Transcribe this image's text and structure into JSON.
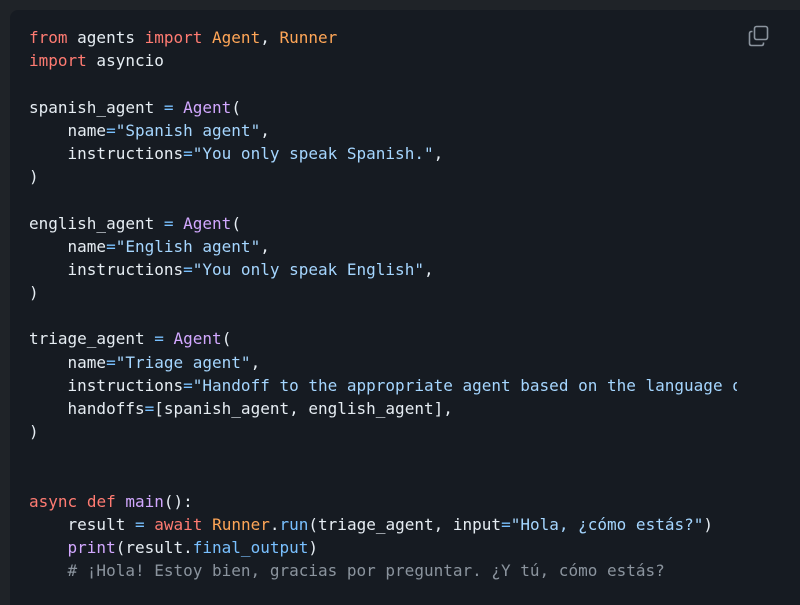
{
  "copy_icon": "copy-icon",
  "colors": {
    "background": "#161b22",
    "text": "#e6edf3",
    "keyword": "#ff7b72",
    "class": "#ffa657",
    "function": "#d2a8ff",
    "string": "#a5d6ff",
    "operator": "#79c0ff",
    "comment": "#8b949e"
  },
  "code_lines": [
    [
      {
        "t": "from",
        "c": "kw"
      },
      {
        "t": " agents ",
        "c": "id"
      },
      {
        "t": "import",
        "c": "kw"
      },
      {
        "t": " ",
        "c": "id"
      },
      {
        "t": "Agent",
        "c": "cls"
      },
      {
        "t": ", ",
        "c": "id"
      },
      {
        "t": "Runner",
        "c": "cls"
      }
    ],
    [
      {
        "t": "import",
        "c": "kw"
      },
      {
        "t": " asyncio",
        "c": "id"
      }
    ],
    [],
    [
      {
        "t": "spanish_agent ",
        "c": "id"
      },
      {
        "t": "=",
        "c": "op"
      },
      {
        "t": " ",
        "c": "id"
      },
      {
        "t": "Agent",
        "c": "fn"
      },
      {
        "t": "(",
        "c": "id"
      }
    ],
    [
      {
        "t": "    name",
        "c": "id"
      },
      {
        "t": "=",
        "c": "op"
      },
      {
        "t": "\"Spanish agent\"",
        "c": "str"
      },
      {
        "t": ",",
        "c": "id"
      }
    ],
    [
      {
        "t": "    instructions",
        "c": "id"
      },
      {
        "t": "=",
        "c": "op"
      },
      {
        "t": "\"You only speak Spanish.\"",
        "c": "str"
      },
      {
        "t": ",",
        "c": "id"
      }
    ],
    [
      {
        "t": ")",
        "c": "id"
      }
    ],
    [],
    [
      {
        "t": "english_agent ",
        "c": "id"
      },
      {
        "t": "=",
        "c": "op"
      },
      {
        "t": " ",
        "c": "id"
      },
      {
        "t": "Agent",
        "c": "fn"
      },
      {
        "t": "(",
        "c": "id"
      }
    ],
    [
      {
        "t": "    name",
        "c": "id"
      },
      {
        "t": "=",
        "c": "op"
      },
      {
        "t": "\"English agent\"",
        "c": "str"
      },
      {
        "t": ",",
        "c": "id"
      }
    ],
    [
      {
        "t": "    instructions",
        "c": "id"
      },
      {
        "t": "=",
        "c": "op"
      },
      {
        "t": "\"You only speak English\"",
        "c": "str"
      },
      {
        "t": ",",
        "c": "id"
      }
    ],
    [
      {
        "t": ")",
        "c": "id"
      }
    ],
    [],
    [
      {
        "t": "triage_agent ",
        "c": "id"
      },
      {
        "t": "=",
        "c": "op"
      },
      {
        "t": " ",
        "c": "id"
      },
      {
        "t": "Agent",
        "c": "fn"
      },
      {
        "t": "(",
        "c": "id"
      }
    ],
    [
      {
        "t": "    name",
        "c": "id"
      },
      {
        "t": "=",
        "c": "op"
      },
      {
        "t": "\"Triage agent\"",
        "c": "str"
      },
      {
        "t": ",",
        "c": "id"
      }
    ],
    [
      {
        "t": "    instructions",
        "c": "id"
      },
      {
        "t": "=",
        "c": "op"
      },
      {
        "t": "\"Handoff to the appropriate agent based on the language o",
        "c": "str"
      }
    ],
    [
      {
        "t": "    handoffs",
        "c": "id"
      },
      {
        "t": "=",
        "c": "op"
      },
      {
        "t": "[spanish_agent, english_agent],",
        "c": "id"
      }
    ],
    [
      {
        "t": ")",
        "c": "id"
      }
    ],
    [],
    [],
    [
      {
        "t": "async",
        "c": "kw"
      },
      {
        "t": " ",
        "c": "id"
      },
      {
        "t": "def",
        "c": "kw"
      },
      {
        "t": " ",
        "c": "id"
      },
      {
        "t": "main",
        "c": "fn"
      },
      {
        "t": "():",
        "c": "id"
      }
    ],
    [
      {
        "t": "    result ",
        "c": "id"
      },
      {
        "t": "=",
        "c": "op"
      },
      {
        "t": " ",
        "c": "id"
      },
      {
        "t": "await",
        "c": "kw"
      },
      {
        "t": " ",
        "c": "id"
      },
      {
        "t": "Runner",
        "c": "cls"
      },
      {
        "t": ".",
        "c": "id"
      },
      {
        "t": "run",
        "c": "op"
      },
      {
        "t": "(triage_agent, input",
        "c": "id"
      },
      {
        "t": "=",
        "c": "op"
      },
      {
        "t": "\"Hola, ¿cómo estás?\"",
        "c": "str"
      },
      {
        "t": ")",
        "c": "id"
      }
    ],
    [
      {
        "t": "    ",
        "c": "id"
      },
      {
        "t": "print",
        "c": "fn"
      },
      {
        "t": "(result.",
        "c": "id"
      },
      {
        "t": "final_output",
        "c": "op"
      },
      {
        "t": ")",
        "c": "id"
      }
    ],
    [
      {
        "t": "    # ¡Hola! Estoy bien, gracias por preguntar. ¿Y tú, cómo estás?",
        "c": "cm"
      }
    ]
  ]
}
